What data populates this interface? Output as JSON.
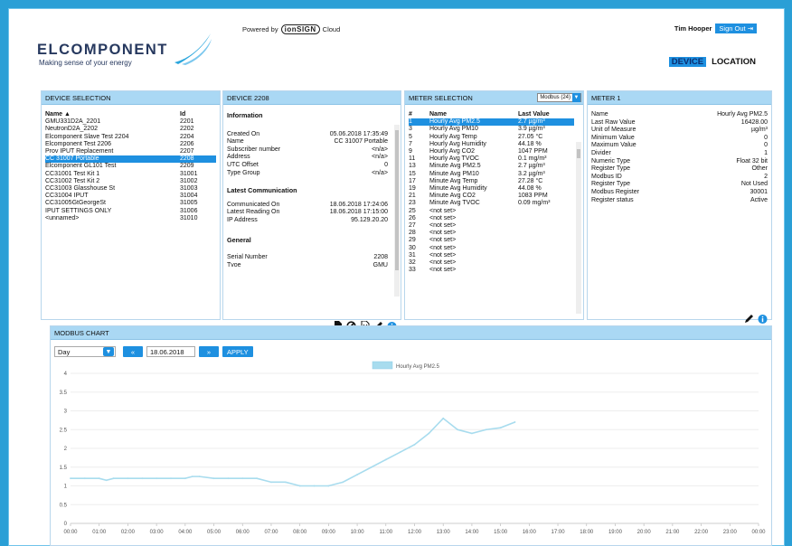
{
  "header": {
    "logo_name": "ELCOMPONENT",
    "logo_tagline": "Making sense of your energy",
    "powered_by": "Powered by",
    "powered_brand": "ionSIGN",
    "powered_suffix": "Cloud",
    "user_name": "Tim Hooper",
    "sign_out": "Sign Out",
    "nav": {
      "device": "DEVICE",
      "location": "LOCATION"
    }
  },
  "device_selection": {
    "title": "DEVICE SELECTION",
    "col_name": "Name ▲",
    "col_id": "Id",
    "rows": [
      {
        "name": "GMU331D2A_2201",
        "id": "2201"
      },
      {
        "name": "NeutronD2A_2202",
        "id": "2202"
      },
      {
        "name": "Elcomponent Slave Test 2204",
        "id": "2204"
      },
      {
        "name": "Elcomponent Test 2206",
        "id": "2206"
      },
      {
        "name": "Prov IPUT Replacement",
        "id": "2207"
      },
      {
        "name": "CC 31007 Portable",
        "id": "2208",
        "selected": true
      },
      {
        "name": "Elcomponent GL101 Test",
        "id": "2209"
      },
      {
        "name": "CC31001 Test Kit 1",
        "id": "31001"
      },
      {
        "name": "CC31002 Test Kit 2",
        "id": "31002"
      },
      {
        "name": "CC31003 Glasshouse St",
        "id": "31003"
      },
      {
        "name": "CC31004 IPUT",
        "id": "31004"
      },
      {
        "name": "CC31005GtGeorgeSt",
        "id": "31005"
      },
      {
        "name": "IPUT SETTINGS ONLY",
        "id": "31006"
      },
      {
        "name": "<unnamed>",
        "id": "31010"
      }
    ]
  },
  "device": {
    "title": "DEVICE 2208",
    "information_head": "Information",
    "information": [
      {
        "k": "Created On",
        "v": "05.06.2018 17:35:49"
      },
      {
        "k": "Name",
        "v": "CC 31007 Portable"
      },
      {
        "k": "Subscriber number",
        "v": "<n/a>"
      },
      {
        "k": "Address",
        "v": "<n/a>"
      },
      {
        "k": "UTC Offset",
        "v": "0"
      },
      {
        "k": "Type Group",
        "v": "<n/a>"
      }
    ],
    "comm_head": "Latest Communication",
    "comm": [
      {
        "k": "Communicated On",
        "v": "18.06.2018 17:24:06"
      },
      {
        "k": "Latest Reading On",
        "v": "18.06.2018 17:15:00"
      },
      {
        "k": "IP Address",
        "v": "95.129.20.20"
      }
    ],
    "general_head": "General",
    "general": [
      {
        "k": "Serial Number",
        "v": "2208"
      },
      {
        "k": "Tvoe",
        "v": "GMU"
      }
    ]
  },
  "meter_selection": {
    "title": "METER SELECTION",
    "dropdown": "Modbus (24)",
    "col_num": "#",
    "col_name": "Name",
    "col_value": "Last Value",
    "rows": [
      {
        "n": "1",
        "name": "Hourly Avg PM2.5",
        "v": "2.7 µg/m³",
        "selected": true
      },
      {
        "n": "3",
        "name": "Hourly Avg PM10",
        "v": "3.9 µg/m³"
      },
      {
        "n": "5",
        "name": "Hourly Avg Temp",
        "v": "27.05 °C"
      },
      {
        "n": "7",
        "name": "Hourly Avg Humidity",
        "v": "44.18 %"
      },
      {
        "n": "9",
        "name": "Hourly Avg CO2",
        "v": "1047 PPM"
      },
      {
        "n": "11",
        "name": "Hourly Avg TVOC",
        "v": "0.1 mg/m³"
      },
      {
        "n": "13",
        "name": "Minute Avg PM2.5",
        "v": "2.7 µg/m³"
      },
      {
        "n": "15",
        "name": "Minute Avg PM10",
        "v": "3.2 µg/m³"
      },
      {
        "n": "17",
        "name": "Minute Avg Temp",
        "v": "27.28 °C"
      },
      {
        "n": "19",
        "name": "Minute Avg Humidity",
        "v": "44.08 %"
      },
      {
        "n": "21",
        "name": "Minute Avg CO2",
        "v": "1083 PPM"
      },
      {
        "n": "23",
        "name": "Minute Avg TVOC",
        "v": "0.09 mg/m³"
      },
      {
        "n": "25",
        "name": "<not set>",
        "v": ""
      },
      {
        "n": "26",
        "name": "<not set>",
        "v": ""
      },
      {
        "n": "27",
        "name": "<not set>",
        "v": ""
      },
      {
        "n": "28",
        "name": "<not set>",
        "v": ""
      },
      {
        "n": "29",
        "name": "<not set>",
        "v": ""
      },
      {
        "n": "30",
        "name": "<not set>",
        "v": ""
      },
      {
        "n": "31",
        "name": "<not set>",
        "v": ""
      },
      {
        "n": "32",
        "name": "<not set>",
        "v": ""
      },
      {
        "n": "33",
        "name": "<not set>",
        "v": ""
      }
    ]
  },
  "meter": {
    "title": "METER 1",
    "rows": [
      {
        "k": "Name",
        "v": "Hourly Avg PM2.5"
      },
      {
        "k": "Last Raw Value",
        "v": "16428.00"
      },
      {
        "k": "Unit of Measure",
        "v": "µg/m³"
      },
      {
        "k": "Minimum Value",
        "v": "0"
      },
      {
        "k": "Maximum Value",
        "v": "0"
      },
      {
        "k": "Divider",
        "v": "1"
      },
      {
        "k": "Numeric Type",
        "v": "Float 32 bit"
      },
      {
        "k": "Register Type",
        "v": "Other"
      },
      {
        "k": "Modbus ID",
        "v": "2"
      },
      {
        "k": "Register Type",
        "v": "Not Used"
      },
      {
        "k": "Modbus Register",
        "v": "30001"
      },
      {
        "k": "Register status",
        "v": "Active"
      }
    ]
  },
  "chart_panel": {
    "title": "MODBUS CHART",
    "period": "Day",
    "prev": "«",
    "date": "18.06.2018",
    "next": "»",
    "apply": "APPLY"
  },
  "chart_data": {
    "type": "line",
    "legend": "Hourly Avg PM2.5",
    "ylim": [
      0,
      4
    ],
    "yticks": [
      "0",
      "0.5",
      "1",
      "1.5",
      "2",
      "2.5",
      "3",
      "3.5",
      "4"
    ],
    "xticks": [
      "00:00",
      "01:00",
      "02:00",
      "03:00",
      "04:00",
      "05:00",
      "06:00",
      "07:00",
      "08:00",
      "09:00",
      "10:00",
      "11:00",
      "12:00",
      "13:00",
      "14:00",
      "15:00",
      "16:00",
      "17:00",
      "18:00",
      "19:00",
      "20:00",
      "21:00",
      "22:00",
      "23:00",
      "00:00"
    ],
    "series": [
      {
        "name": "Hourly Avg PM2.5",
        "color": "#a8dcee",
        "x": [
          0,
          0.5,
          1,
          1.25,
          1.5,
          2,
          2.5,
          3,
          3.5,
          4,
          4.25,
          4.5,
          5,
          5.5,
          6,
          6.5,
          7,
          7.5,
          8,
          8.5,
          9,
          9.5,
          10,
          10.5,
          11,
          11.5,
          12,
          12.5,
          13,
          13.5,
          14,
          14.5,
          15,
          15.5
        ],
        "y": [
          1.2,
          1.2,
          1.2,
          1.15,
          1.2,
          1.2,
          1.2,
          1.2,
          1.2,
          1.2,
          1.25,
          1.25,
          1.2,
          1.2,
          1.2,
          1.2,
          1.1,
          1.1,
          1.0,
          1.0,
          1.0,
          1.1,
          1.3,
          1.5,
          1.7,
          1.9,
          2.1,
          2.4,
          2.8,
          2.5,
          2.4,
          2.5,
          2.55,
          2.7
        ]
      }
    ]
  }
}
